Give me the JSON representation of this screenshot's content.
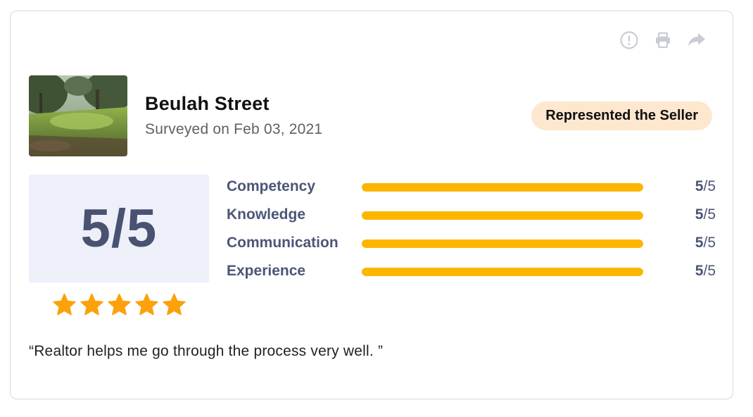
{
  "toolbar": {
    "icons": [
      "alert-circle-icon",
      "printer-icon",
      "share-forward-icon"
    ],
    "icon_color": "#c9ccd6"
  },
  "listing": {
    "thumbnail": "property-photo",
    "title": "Beulah Street",
    "subtitle": "Surveyed on Feb 03, 2021",
    "badge": "Represented the Seller",
    "badge_color": "#fde8cf"
  },
  "overall": {
    "score": "5/5",
    "stars": 5,
    "star_color": "#fca10a"
  },
  "ratings": [
    {
      "label": "Competency",
      "score": "5",
      "max": "/5",
      "fraction": 1.0
    },
    {
      "label": "Knowledge",
      "score": "5",
      "max": "/5",
      "fraction": 1.0
    },
    {
      "label": "Communication",
      "score": "5",
      "max": "/5",
      "fraction": 1.0
    },
    {
      "label": "Experience",
      "score": "5",
      "max": "/5",
      "fraction": 1.0
    }
  ],
  "bar_color": "#fdb600",
  "review": {
    "quote": "“Realtor helps me go through the process very well. ”"
  }
}
